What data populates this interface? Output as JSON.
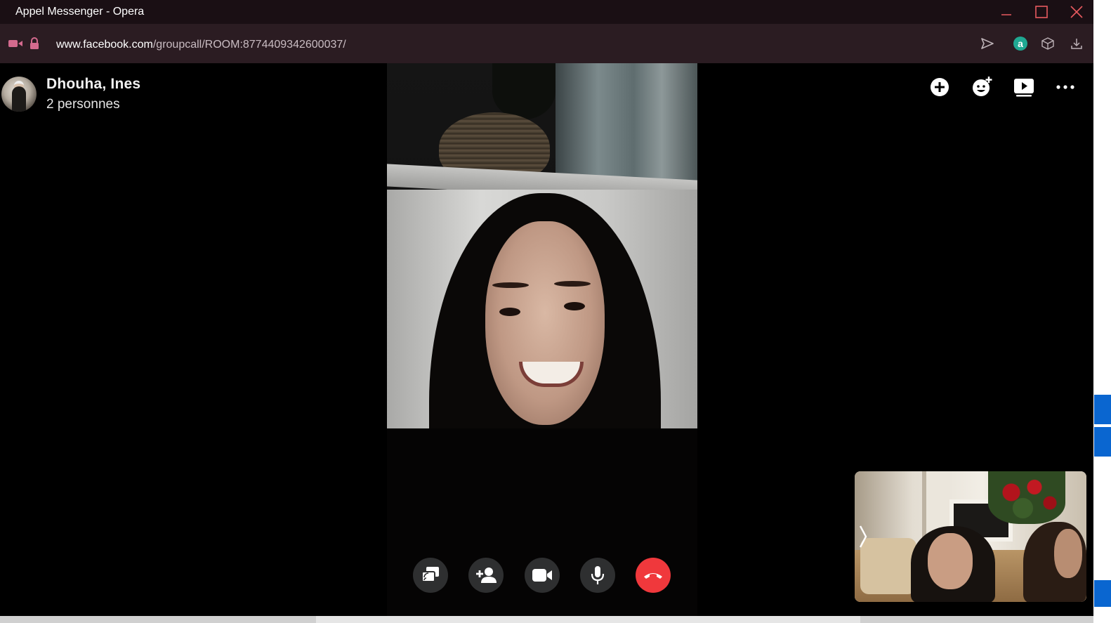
{
  "window": {
    "title": "Appel Messenger - Opera"
  },
  "address_bar": {
    "url_host": "www.facebook.com",
    "url_path": "/groupcall/ROOM:8774409342600037/",
    "icons": [
      "video-camera-icon",
      "lock-icon",
      "send-icon",
      "account-a-icon",
      "box-3d-icon",
      "download-icon"
    ],
    "accent_color": "#1fa892"
  },
  "call": {
    "title": "Dhouha, Ines",
    "participants": "2 personnes"
  },
  "top_actions": [
    "add-icon",
    "emoji-add-icon",
    "watch-together-icon",
    "more-icon"
  ],
  "controls": {
    "buttons": [
      "share-screen",
      "add-person",
      "camera",
      "microphone",
      "end-call"
    ],
    "end_call_color": "#f0383c"
  },
  "self_view": {
    "toggle_glyph": "⟩"
  }
}
